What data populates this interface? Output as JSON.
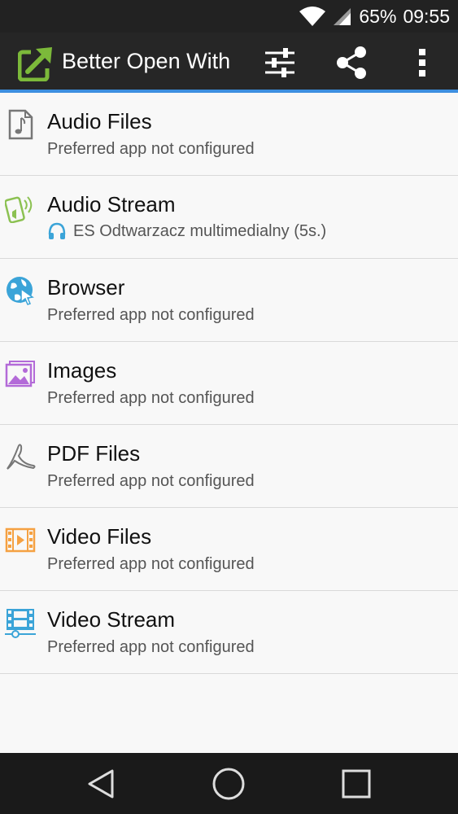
{
  "status_bar": {
    "battery": "65%",
    "time": "09:55"
  },
  "app_bar": {
    "title": "Better Open With",
    "actions": [
      "sliders-icon",
      "share-icon",
      "more-vert-icon"
    ]
  },
  "items": [
    {
      "title": "Audio Files",
      "subtitle": "Preferred app not configured",
      "icon": "music-file-icon",
      "icon_color": "#777777"
    },
    {
      "title": "Audio Stream",
      "subtitle": "ES Odtwarzacz multimedialny (5s.)",
      "icon": "phone-audio-icon",
      "icon_color": "#8cc152",
      "subtitle_icon": "headphones-icon"
    },
    {
      "title": "Browser",
      "subtitle": "Preferred app not configured",
      "icon": "globe-cursor-icon",
      "icon_color": "#3ba4d8"
    },
    {
      "title": "Images",
      "subtitle": "Preferred app not configured",
      "icon": "image-icon",
      "icon_color": "#b36ad8"
    },
    {
      "title": "PDF Files",
      "subtitle": "Preferred app not configured",
      "icon": "pdf-icon",
      "icon_color": "#777777"
    },
    {
      "title": "Video Files",
      "subtitle": "Preferred app not configured",
      "icon": "film-icon",
      "icon_color": "#f5a142"
    },
    {
      "title": "Video Stream",
      "subtitle": "Preferred app not configured",
      "icon": "film-stream-icon",
      "icon_color": "#3ba4d8"
    }
  ],
  "nav_bar": {
    "buttons": [
      "back-icon",
      "home-icon",
      "recents-icon"
    ]
  },
  "colors": {
    "accent": "#3d8fe0",
    "app_bar": "#262626",
    "logo_green": "#7cb93a"
  }
}
